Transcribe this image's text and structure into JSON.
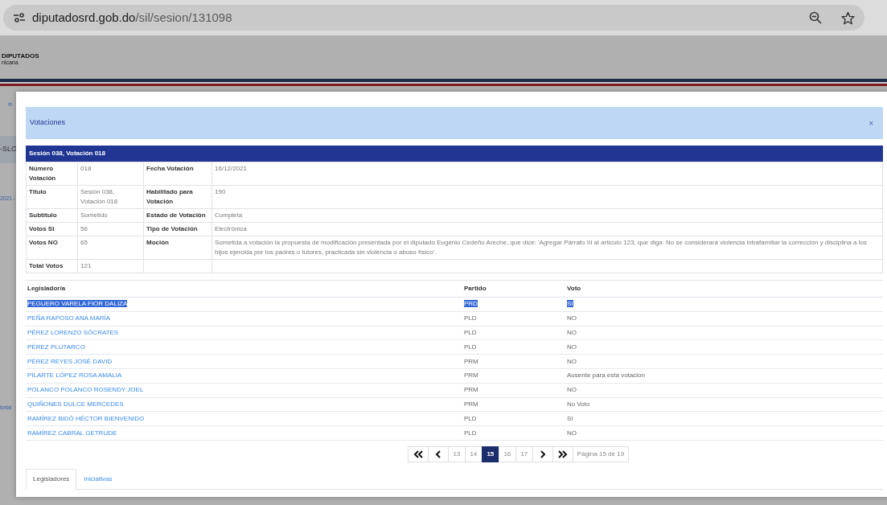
{
  "browser": {
    "url_host": "diputadosrd.gob.do",
    "url_path": "/sil/sesion/131098"
  },
  "background": {
    "logo_title": "DIPUTADOS",
    "logo_subtitle": "nicana",
    "fragments": [
      {
        "text": "In",
        "kind": "link"
      },
      {
        "text": "-SLO",
        "kind": "banner"
      },
      {
        "text": "2021 -",
        "kind": "link"
      },
      {
        "text": "torial",
        "kind": "link"
      }
    ]
  },
  "modal": {
    "title": "Votaciones",
    "close": "×",
    "section_title": "Sesión 038, Votación 018",
    "details": [
      [
        "Número Votación",
        "018",
        "Fecha Votación",
        "16/12/2021"
      ],
      [
        "Titulo",
        "Sesión 038, Votación 018",
        "Habilitado para Votación",
        "190"
      ],
      [
        "Subtitulo",
        "Sometido",
        "Estado de Votación",
        "Completa"
      ],
      [
        "Votos SI",
        "56",
        "Tipo de Votación",
        "Electrónica"
      ],
      [
        "Votos NO",
        "65",
        "Moción",
        "Sometida a votación la propuesta de modificación presentada por el diputado Eugenio Cedeño Areche, que dice: 'Agregar Párrafo III al articulo 123, que diga: No se considerará violencia intrafamiliar la corrección y disciplina a los hijos ejercida por los padres o tutores, practicada sin violencia o abuso físico'."
      ],
      [
        "Total Votos",
        "121"
      ]
    ],
    "legislators": {
      "columns": [
        "Legislador/a",
        "Partido",
        "Voto"
      ],
      "rows": [
        {
          "name": "PEGUERO VARELA FIOR DALIZA",
          "party": "PRD",
          "vote": "SI",
          "highlighted": true
        },
        {
          "name": "PEÑA RAPOSO ANA MARÍA",
          "party": "PLD",
          "vote": "NO",
          "highlighted": false
        },
        {
          "name": "PÉREZ LORENZO SÓCRATES",
          "party": "PLD",
          "vote": "NO",
          "highlighted": false
        },
        {
          "name": "PÉREZ PLUTARCO",
          "party": "PLD",
          "vote": "NO",
          "highlighted": false
        },
        {
          "name": "PÉREZ REYES JOSÉ DAVID",
          "party": "PRM",
          "vote": "NO",
          "highlighted": false
        },
        {
          "name": "PILARTE LÓPEZ ROSA AMALIA",
          "party": "PRM",
          "vote": "Ausente para esta votacion",
          "highlighted": false
        },
        {
          "name": "POLANCO POLANCO ROSENDY JOEL",
          "party": "PRM",
          "vote": "NO",
          "highlighted": false
        },
        {
          "name": "QUIÑONES DULCE MERCEDES",
          "party": "PRM",
          "vote": "No Voto",
          "highlighted": false
        },
        {
          "name": "RAMÍREZ BIDÓ HÉCTOR BIENVENIDO",
          "party": "PLD",
          "vote": "SI",
          "highlighted": false
        },
        {
          "name": "RAMÍREZ CABRAL GETRUDE",
          "party": "PLD",
          "vote": "NO",
          "highlighted": false
        }
      ]
    },
    "pagination": [
      {
        "kind": "first"
      },
      {
        "kind": "prev"
      },
      {
        "kind": "page",
        "label": "13",
        "selected": false
      },
      {
        "kind": "page",
        "label": "14",
        "selected": false
      },
      {
        "kind": "page",
        "label": "15",
        "selected": true
      },
      {
        "kind": "page",
        "label": "16",
        "selected": false
      },
      {
        "kind": "page",
        "label": "17",
        "selected": false
      },
      {
        "kind": "next"
      },
      {
        "kind": "last"
      },
      {
        "kind": "info",
        "label": "Página 15 de 19"
      }
    ],
    "tabs": [
      {
        "label": "Legisladores",
        "selected": true
      },
      {
        "label": "Iniciativas",
        "selected": false
      }
    ]
  }
}
